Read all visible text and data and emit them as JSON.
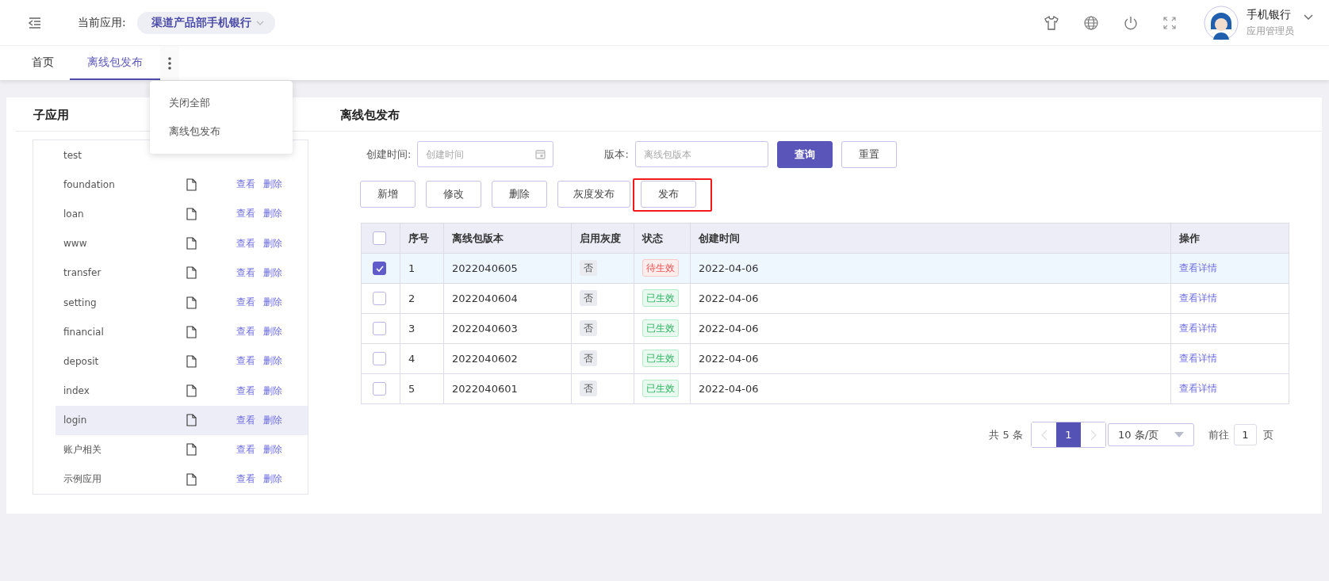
{
  "header": {
    "current_app_label": "当前应用:",
    "current_app": "渠道产品部手机银行",
    "user": {
      "name": "手机银行",
      "role": "应用管理员"
    }
  },
  "tabs": [
    {
      "label": "首页",
      "selected": false
    },
    {
      "label": "离线包发布",
      "selected": true
    }
  ],
  "tab_menu": {
    "items": [
      "关闭全部",
      "离线包发布"
    ]
  },
  "sub_apps": {
    "title": "子应用",
    "items": [
      {
        "name": "test",
        "selected": false
      },
      {
        "name": "foundation",
        "view": "查看",
        "delete": "删除",
        "selected": false
      },
      {
        "name": "loan",
        "view": "查看",
        "delete": "删除",
        "selected": false
      },
      {
        "name": "www",
        "view": "查看",
        "delete": "删除",
        "selected": false
      },
      {
        "name": "transfer",
        "view": "查看",
        "delete": "删除",
        "selected": false
      },
      {
        "name": "setting",
        "view": "查看",
        "delete": "删除",
        "selected": false
      },
      {
        "name": "financial",
        "view": "查看",
        "delete": "删除",
        "selected": false
      },
      {
        "name": "deposit",
        "view": "查看",
        "delete": "删除",
        "selected": false
      },
      {
        "name": "index",
        "view": "查看",
        "delete": "删除",
        "selected": false
      },
      {
        "name": "login",
        "view": "查看",
        "delete": "删除",
        "selected": true
      },
      {
        "name": "账户相关",
        "view": "查看",
        "delete": "删除",
        "selected": false
      },
      {
        "name": "示例应用",
        "view": "查看",
        "delete": "删除",
        "selected": false
      }
    ]
  },
  "release": {
    "title": "离线包发布",
    "filters": [
      {
        "label": "创建时间:",
        "placeholder": "创建时间",
        "kind": "date"
      },
      {
        "label": "版本:",
        "placeholder": "离线包版本",
        "kind": "text"
      }
    ],
    "search_button": "查询",
    "reset_button": "重置",
    "actions": [
      {
        "label": "新增",
        "highlighted": false
      },
      {
        "label": "修改",
        "highlighted": false
      },
      {
        "label": "删除",
        "highlighted": false
      },
      {
        "label": "灰度发布",
        "highlighted": false
      },
      {
        "label": "发布",
        "highlighted": true
      }
    ],
    "table": {
      "all_checked": false,
      "columns": [
        "序号",
        "离线包版本",
        "启用灰度",
        "状态",
        "创建时间",
        "操作"
      ],
      "rows": [
        {
          "checked": true,
          "index": "1",
          "version": "2022040605",
          "gray": "否",
          "status": {
            "label": "待生效",
            "kind": "pending"
          },
          "created": "2022-04-06",
          "action": "查看详情"
        },
        {
          "checked": false,
          "index": "2",
          "version": "2022040604",
          "gray": "否",
          "status": {
            "label": "已生效",
            "kind": "active"
          },
          "created": "2022-04-06",
          "action": "查看详情"
        },
        {
          "checked": false,
          "index": "3",
          "version": "2022040603",
          "gray": "否",
          "status": {
            "label": "已生效",
            "kind": "active"
          },
          "created": "2022-04-06",
          "action": "查看详情"
        },
        {
          "checked": false,
          "index": "4",
          "version": "2022040602",
          "gray": "否",
          "status": {
            "label": "已生效",
            "kind": "active"
          },
          "created": "2022-04-06",
          "action": "查看详情"
        },
        {
          "checked": false,
          "index": "5",
          "version": "2022040601",
          "gray": "否",
          "status": {
            "label": "已生效",
            "kind": "active"
          },
          "created": "2022-04-06",
          "action": "查看详情"
        }
      ]
    },
    "pagination": {
      "total": "共 5 条",
      "pages": [
        {
          "label": "1",
          "selected": true
        }
      ],
      "page_size": "10 条/页",
      "goto_label": "前往",
      "goto_value": "1",
      "goto_suffix": "页"
    }
  }
}
